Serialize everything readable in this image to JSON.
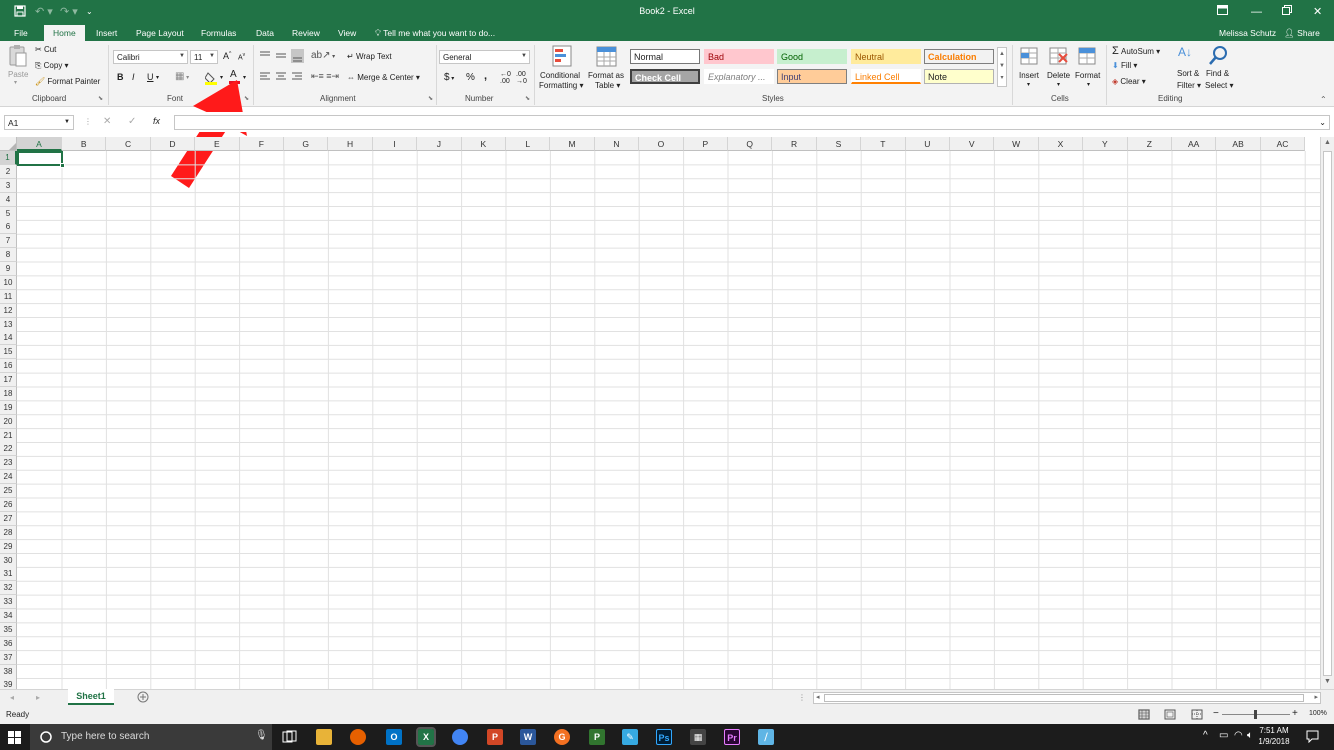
{
  "window": {
    "title": "Book2 - Excel",
    "user": "Melissa Schutz",
    "share": "Share"
  },
  "tabs": [
    "File",
    "Home",
    "Insert",
    "Page Layout",
    "Formulas",
    "Data",
    "Review",
    "View"
  ],
  "tell_me": "Tell me what you want to do...",
  "clipboard": {
    "paste": "Paste",
    "cut": "Cut",
    "copy": "Copy",
    "format_painter": "Format Painter",
    "label": "Clipboard"
  },
  "font": {
    "name": "Calibri",
    "size": "11",
    "bold": "B",
    "italic": "I",
    "underline": "U",
    "color_glyph": "A",
    "label": "Font"
  },
  "alignment": {
    "wrap_text": "Wrap Text",
    "merge_center": "Merge & Center",
    "label": "Alignment"
  },
  "number": {
    "format": "General",
    "currency": "$",
    "percent": "%",
    "comma": ",",
    "label": "Number"
  },
  "styles": {
    "conditional_formatting": [
      "Conditional",
      "Formatting"
    ],
    "format_as_table": [
      "Format as",
      "Table"
    ],
    "cells": [
      "Normal",
      "Bad",
      "Good",
      "Neutral",
      "Calculation",
      "Check Cell",
      "Explanatory ...",
      "Input",
      "Linked Cell",
      "Note"
    ],
    "label": "Styles"
  },
  "cells_group": {
    "insert": "Insert",
    "delete": "Delete",
    "format": "Format",
    "label": "Cells"
  },
  "editing": {
    "autosum": "AutoSum",
    "fill": "Fill",
    "clear": "Clear",
    "sort_filter": [
      "Sort &",
      "Filter"
    ],
    "find_select": [
      "Find &",
      "Select"
    ],
    "label": "Editing"
  },
  "formula_bar": {
    "name_box": "A1",
    "fx": "fx",
    "cancel": "✕",
    "enter": "✓"
  },
  "columns": [
    "A",
    "B",
    "C",
    "D",
    "E",
    "F",
    "G",
    "H",
    "I",
    "J",
    "K",
    "L",
    "M",
    "N",
    "O",
    "P",
    "Q",
    "R",
    "S",
    "T",
    "U",
    "V",
    "W",
    "X",
    "Y",
    "Z",
    "AA",
    "AB",
    "AC"
  ],
  "rows": [
    "1",
    "2",
    "3",
    "4",
    "5",
    "6",
    "7",
    "8",
    "9",
    "10",
    "11",
    "12",
    "13",
    "14",
    "15",
    "16",
    "17",
    "18",
    "19",
    "20",
    "21",
    "22",
    "23",
    "24",
    "25",
    "26",
    "27",
    "28",
    "29",
    "30",
    "31",
    "32",
    "33",
    "34",
    "35",
    "36",
    "37",
    "38",
    "39"
  ],
  "sheet_tab": "Sheet1",
  "status": {
    "ready": "Ready",
    "zoom": "100%"
  },
  "taskbar": {
    "search": "Type here to search",
    "time": "7:51 AM",
    "date": "1/9/2018"
  }
}
